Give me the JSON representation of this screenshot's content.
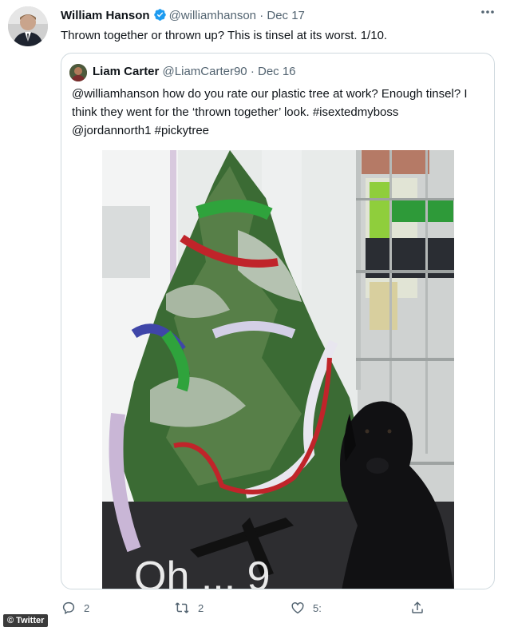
{
  "author": {
    "name": "William Hanson",
    "handle": "@williamhanson",
    "separator": "·",
    "date": "Dec 17",
    "text": "Thrown together or thrown up? This is tinsel at its worst. 1/10."
  },
  "quoted": {
    "name": "Liam Carter",
    "handle": "@LiamCarter90",
    "separator": "·",
    "date": "Dec 16",
    "mention1": "@williamhanson",
    "body1": "  how do you rate our plastic tree at work? Enough tinsel? I think they went for the ‘thrown together’ look. ",
    "hashtag1": "#isextedmyboss",
    "mention2": "@jordannorth1",
    "hashtag2": "#pickytree",
    "photo_caption": "Oh ... 9"
  },
  "actions": {
    "reply_count": "2",
    "retweet_count": "2",
    "like_count": "5:"
  },
  "badge": "© Twitter",
  "colors": {
    "verified": "#1d9bf0",
    "muted": "#536471",
    "border": "#cfd9de"
  },
  "icons": [
    "verified-icon",
    "more-icon",
    "reply-icon",
    "retweet-icon",
    "like-icon",
    "share-icon"
  ]
}
